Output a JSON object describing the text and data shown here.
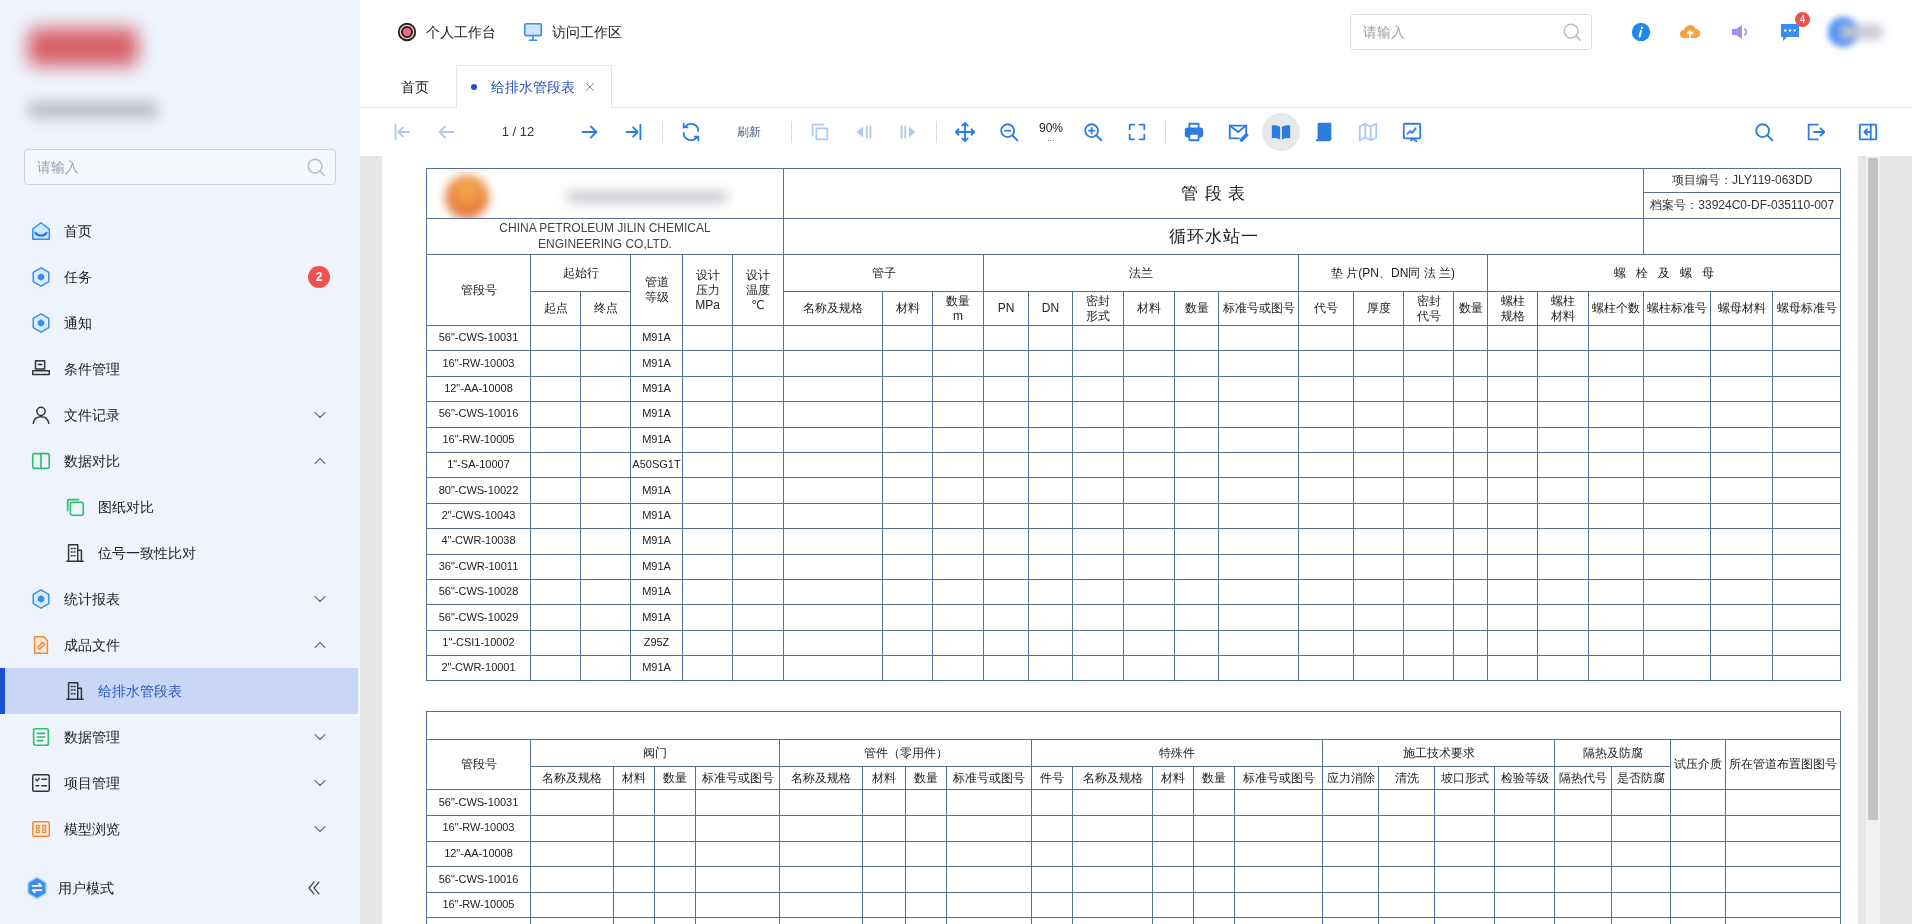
{
  "sidebar": {
    "search": {
      "placeholder": "请输入"
    },
    "items": [
      {
        "label": "首页",
        "kind": "link",
        "selected": false
      },
      {
        "label": "任务",
        "kind": "link",
        "badge": "2",
        "selected": false
      },
      {
        "label": "通知",
        "kind": "link",
        "selected": false
      },
      {
        "label": "条件管理",
        "kind": "link",
        "selected": false
      },
      {
        "label": "文件记录",
        "kind": "group",
        "expanded": false,
        "selected": false
      },
      {
        "label": "数据对比",
        "kind": "group",
        "expanded": true,
        "selected": false,
        "children": [
          {
            "label": "图纸对比",
            "selected": false
          },
          {
            "label": "位号一致性比对",
            "selected": false
          }
        ]
      },
      {
        "label": "统计报表",
        "kind": "group",
        "expanded": false,
        "selected": false
      },
      {
        "label": "成品文件",
        "kind": "group",
        "expanded": true,
        "selected": false,
        "children": [
          {
            "label": "给排水管段表",
            "selected": true
          }
        ]
      },
      {
        "label": "数据管理",
        "kind": "group",
        "expanded": false,
        "selected": false
      },
      {
        "label": "项目管理",
        "kind": "group",
        "expanded": false,
        "selected": false
      },
      {
        "label": "模型浏览",
        "kind": "group",
        "expanded": false,
        "selected": false
      }
    ],
    "footer": {
      "label": "用户模式"
    }
  },
  "header": {
    "links": [
      "个人工作台",
      "访问工作区"
    ],
    "search": {
      "placeholder": "请输入"
    },
    "message_badge": "4"
  },
  "tabs": [
    {
      "label": "首页",
      "selected": false,
      "closable": false
    },
    {
      "label": "给排水管段表",
      "selected": true,
      "closable": true
    }
  ],
  "toolbar": {
    "left": [
      {
        "kind": "icon",
        "disabled": true,
        "selected": false
      },
      {
        "kind": "icon",
        "disabled": true,
        "selected": false
      },
      {
        "kind": "text",
        "text": "1 / 12"
      },
      {
        "kind": "icon",
        "disabled": false,
        "selected": false
      },
      {
        "kind": "icon",
        "disabled": false,
        "selected": false
      },
      {
        "kind": "separator"
      },
      {
        "kind": "icon",
        "disabled": false,
        "selected": false
      },
      {
        "kind": "link",
        "text": "刷新"
      },
      {
        "kind": "separator"
      },
      {
        "kind": "icon",
        "disabled": true,
        "selected": false
      },
      {
        "kind": "icon",
        "disabled": true,
        "selected": false
      },
      {
        "kind": "icon",
        "disabled": true,
        "selected": false
      },
      {
        "kind": "separator"
      },
      {
        "kind": "icon",
        "disabled": false,
        "selected": false
      },
      {
        "kind": "icon",
        "disabled": false,
        "selected": false
      },
      {
        "kind": "zoom",
        "text": "90%",
        "sub": "..."
      },
      {
        "kind": "icon",
        "disabled": false,
        "selected": false
      },
      {
        "kind": "icon",
        "disabled": false,
        "selected": false
      },
      {
        "kind": "separator"
      },
      {
        "kind": "icon",
        "disabled": false,
        "selected": false
      },
      {
        "kind": "icon",
        "disabled": false,
        "selected": false
      },
      {
        "kind": "icon",
        "disabled": false,
        "selected": true
      },
      {
        "kind": "icon",
        "disabled": false,
        "selected": false
      },
      {
        "kind": "icon",
        "disabled": true,
        "selected": false
      },
      {
        "kind": "icon",
        "disabled": false,
        "selected": false
      }
    ],
    "right": [
      {
        "kind": "icon",
        "disabled": false,
        "selected": false
      },
      {
        "kind": "icon",
        "disabled": false,
        "selected": false
      },
      {
        "kind": "icon",
        "disabled": false,
        "selected": false
      }
    ]
  },
  "document": {
    "pipe_table": {
      "company_lines": [
        "CHINA PETROLEUM JILIN CHEMICAL",
        "ENGINEERING CO,LTD."
      ],
      "title": "管 段 表",
      "station": "循环水站一",
      "project_no": "项目编号：JLY119-063DD",
      "archive_no": "档案号：33924C0-DF-035110-007",
      "header_groups": [
        {
          "label": "管段号"
        },
        {
          "label": "起始行",
          "columns": [
            "起点",
            "终点"
          ]
        },
        {
          "label": "管道等级"
        },
        {
          "label": "设计压力MPa"
        },
        {
          "label": "设计温度℃"
        },
        {
          "label": "管子",
          "columns": [
            "名称及规格",
            "材料",
            "数量m"
          ]
        },
        {
          "label": "法兰",
          "columns": [
            "PN",
            "DN",
            "密封形式",
            "材料",
            "数量",
            "标准号或图号"
          ]
        },
        {
          "label": "垫 片(PN、DN同 法 兰)",
          "columns": [
            "代号",
            "厚度",
            "密封代号",
            "数量"
          ]
        },
        {
          "label": "螺   栓   及   螺   母",
          "columns": [
            "螺柱规格",
            "螺柱材料",
            "螺柱个数",
            "螺柱标准号",
            "螺母材料",
            "螺母标准号"
          ]
        }
      ],
      "rows": [
        {
          "pipe_no": "56\"-CWS-10031",
          "grade": "M91A"
        },
        {
          "pipe_no": "16\"-RW-10003",
          "grade": "M91A"
        },
        {
          "pipe_no": "12\"-AA-10008",
          "grade": "M91A"
        },
        {
          "pipe_no": "56\"-CWS-10016",
          "grade": "M91A"
        },
        {
          "pipe_no": "16\"-RW-10005",
          "grade": "M91A"
        },
        {
          "pipe_no": "1\"-SA-10007",
          "grade": "A50SG1T"
        },
        {
          "pipe_no": "80\"-CWS-10022",
          "grade": "M91A"
        },
        {
          "pipe_no": "2\"-CWS-10043",
          "grade": "M91A"
        },
        {
          "pipe_no": "4\"-CWR-10038",
          "grade": "M91A"
        },
        {
          "pipe_no": "36\"-CWR-10011",
          "grade": "M91A"
        },
        {
          "pipe_no": "56\"-CWS-10028",
          "grade": "M91A"
        },
        {
          "pipe_no": "56\"-CWS-10029",
          "grade": "M91A"
        },
        {
          "pipe_no": "1\"-CSI1-10002",
          "grade": "Z95Z"
        },
        {
          "pipe_no": "2\"-CWR-10001",
          "grade": "M91A"
        }
      ]
    },
    "fittings_table": {
      "header_groups": [
        {
          "label": "管段号"
        },
        {
          "label": "阀门",
          "columns": [
            "名称及规格",
            "材料",
            "数量",
            "标准号或图号"
          ]
        },
        {
          "label": "管件（零用件）",
          "columns": [
            "名称及规格",
            "材料",
            "数量",
            "标准号或图号"
          ]
        },
        {
          "label": "特殊件",
          "columns": [
            "件号",
            "名称及规格",
            "材料",
            "数量",
            "标准号或图号"
          ]
        },
        {
          "label": "施工技术要求",
          "columns": [
            "应力消除",
            "清洗",
            "坡口形式",
            "检验等级"
          ]
        },
        {
          "label": "隔热及防腐",
          "columns": [
            "隔热代号",
            "是否防腐"
          ]
        },
        {
          "label": "试压介质"
        },
        {
          "label": "所在管道布置图图号"
        }
      ],
      "rows": [
        "56\"-CWS-10031",
        "16\"-RW-10003",
        "12\"-AA-10008",
        "56\"-CWS-10016",
        "16\"-RW-10005"
      ]
    }
  }
}
